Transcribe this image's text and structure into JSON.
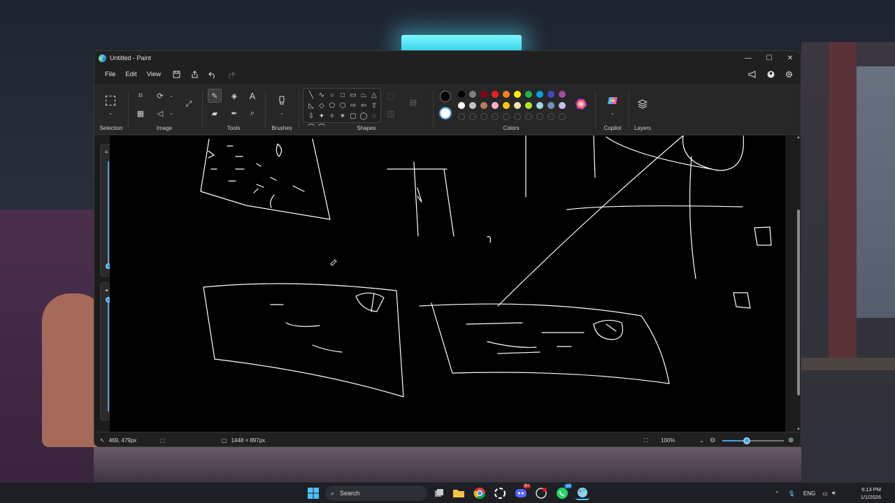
{
  "window": {
    "title": "Untitled - Paint",
    "minimize_glyph": "—",
    "maximize_glyph": "☐",
    "close_glyph": "✕"
  },
  "menu": {
    "file": "File",
    "edit": "Edit",
    "view": "View"
  },
  "ribbon": {
    "groups": {
      "selection": "Selection",
      "image": "Image",
      "tools": "Tools",
      "brushes": "Brushes",
      "shapes": "Shapes",
      "colors": "Colors",
      "copilot": "Copilot",
      "layers": "Layers"
    },
    "shape_glyphs": [
      "╲",
      "∿",
      "○",
      "□",
      "▭",
      "⏢",
      "△",
      "◺",
      "◇",
      "⬠",
      "⬡",
      "⇨",
      "⇦",
      "⇧",
      "⇩",
      "✦",
      "✧",
      "✶",
      "▢",
      "◯",
      "◌",
      "⌒",
      "⌒"
    ],
    "palette_row1": [
      "#000000",
      "#7f7f7f",
      "#880015",
      "#ed1c24",
      "#ff7f27",
      "#fff200",
      "#22b14c",
      "#00a2e8",
      "#3f48cc",
      "#a349a4"
    ],
    "palette_row2": [
      "#ffffff",
      "#c3c3c3",
      "#b97a57",
      "#ffaec9",
      "#ffc90e",
      "#efe4b0",
      "#b5e61d",
      "#99d9ea",
      "#7092be",
      "#c8bfe7"
    ],
    "primary_color": "#000000",
    "secondary_color": "#ffffff"
  },
  "status": {
    "cursor_position": "469, 479px",
    "canvas_size": "1448 × 897px",
    "zoom_level": "100%",
    "zoom_fraction": 0.4
  },
  "taskbar": {
    "search_placeholder": "Search",
    "language": "ENG",
    "time": "6:13 PM",
    "date": "1/1/2026",
    "discord_badge": "9+",
    "whatsapp_badge": "10"
  }
}
